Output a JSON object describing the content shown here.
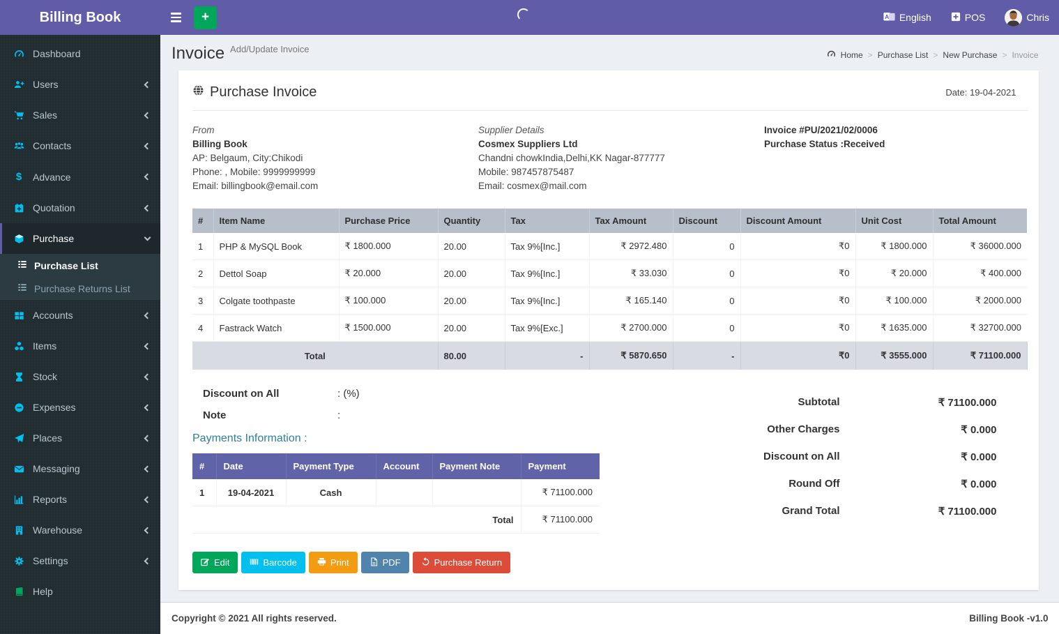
{
  "app": {
    "title": "Billing Book",
    "copyright": "Copyright © 2021 All rights reserved.",
    "version_label": "Billing Book -v1.0"
  },
  "topbar": {
    "language_label": "English",
    "pos_label": "POS",
    "user_name": "Chris"
  },
  "sidebar": {
    "items": [
      {
        "label": "Dashboard",
        "icon": "gauge-icon"
      },
      {
        "label": "Users",
        "icon": "user-plus-icon"
      },
      {
        "label": "Sales",
        "icon": "cart-icon"
      },
      {
        "label": "Contacts",
        "icon": "users-icon"
      },
      {
        "label": "Advance",
        "icon": "dollar-icon"
      },
      {
        "label": "Quotation",
        "icon": "calendar-plus-icon"
      },
      {
        "label": "Purchase",
        "icon": "cube-icon"
      },
      {
        "label": "Accounts",
        "icon": "grid-icon"
      },
      {
        "label": "Items",
        "icon": "cubes-icon"
      },
      {
        "label": "Stock",
        "icon": "hourglass-icon"
      },
      {
        "label": "Expenses",
        "icon": "minus-circle-icon"
      },
      {
        "label": "Places",
        "icon": "paper-plane-icon"
      },
      {
        "label": "Messaging",
        "icon": "envelope-icon"
      },
      {
        "label": "Reports",
        "icon": "bar-chart-icon"
      },
      {
        "label": "Warehouse",
        "icon": "building-icon"
      },
      {
        "label": "Settings",
        "icon": "gears-icon"
      },
      {
        "label": "Help",
        "icon": "book-icon"
      }
    ],
    "purchase_submenu": [
      {
        "label": "Purchase List",
        "active": true
      },
      {
        "label": "Purchase Returns List",
        "active": false
      }
    ]
  },
  "page": {
    "title": "Invoice",
    "subtitle": "Add/Update Invoice",
    "breadcrumb": [
      "Home",
      "Purchase List",
      "New Purchase",
      "Invoice"
    ]
  },
  "invoice": {
    "card_title": "Purchase Invoice",
    "date_label": "Date: 19-04-2021",
    "from": {
      "heading": "From",
      "name": "Billing Book",
      "address": "AP: Belgaum, City:Chikodi",
      "phone": "Phone: , Mobile: 9999999999",
      "email": "Email: billingbook@email.com"
    },
    "supplier": {
      "heading": "Supplier Details",
      "name": "Cosmex Suppliers Ltd",
      "address": "Chandni chowkIndia,Delhi,KK Nagar-877777",
      "mobile": "Mobile: 987457875487",
      "email": "Email: cosmex@mail.com"
    },
    "meta": {
      "number": "Invoice #PU/2021/02/0006",
      "status": "Purchase Status :Received"
    },
    "items_table": {
      "headers": [
        "#",
        "Item Name",
        "Purchase Price",
        "Quantity",
        "Tax",
        "Tax Amount",
        "Discount",
        "Discount Amount",
        "Unit Cost",
        "Total Amount"
      ],
      "rows": [
        [
          "1",
          "PHP & MySQL Book",
          "₹ 1800.000",
          "20.00",
          "Tax 9%[Inc.]",
          "₹ 2972.480",
          "0",
          "₹0",
          "₹ 1800.000",
          "₹ 36000.000"
        ],
        [
          "2",
          "Dettol Soap",
          "₹ 20.000",
          "20.00",
          "Tax 9%[Inc.]",
          "₹ 33.030",
          "0",
          "₹0",
          "₹ 20.000",
          "₹ 400.000"
        ],
        [
          "3",
          "Colgate toothpaste",
          "₹ 100.000",
          "20.00",
          "Tax 9%[Inc.]",
          "₹ 165.140",
          "0",
          "₹0",
          "₹ 100.000",
          "₹ 2000.000"
        ],
        [
          "4",
          "Fastrack Watch",
          "₹ 1500.000",
          "20.00",
          "Tax 9%[Exc.]",
          "₹ 2700.000",
          "0",
          "₹0",
          "₹ 1635.000",
          "₹ 32700.000"
        ]
      ],
      "total_row": [
        "Total",
        "80.00",
        "-",
        "₹ 5870.650",
        "-",
        "₹0",
        "₹ 3555.000",
        "₹ 71100.000"
      ]
    },
    "discount_on_all_label": "Discount on All",
    "discount_on_all_value": ": (%)",
    "note_label": "Note",
    "note_value": ":",
    "payments": {
      "heading": "Payments Information :",
      "headers": [
        "#",
        "Date",
        "Payment Type",
        "Account",
        "Payment Note",
        "Payment"
      ],
      "rows": [
        [
          "1",
          "19-04-2021",
          "Cash",
          "",
          "",
          "₹ 71100.000"
        ]
      ],
      "total_label": "Total",
      "total_value": "₹ 71100.000"
    },
    "summary": [
      {
        "label": "Subtotal",
        "value": "₹ 71100.000"
      },
      {
        "label": "Other Charges",
        "value": "₹ 0.000"
      },
      {
        "label": "Discount on All",
        "value": "₹ 0.000"
      },
      {
        "label": "Round Off",
        "value": "₹ 0.000"
      },
      {
        "label": "Grand Total",
        "value": "₹ 71100.000"
      }
    ],
    "actions": [
      {
        "label": "Edit",
        "icon": "edit-icon",
        "color": "#00a65a"
      },
      {
        "label": "Barcode",
        "icon": "barcode-icon",
        "color": "#00c0ef"
      },
      {
        "label": "Print",
        "icon": "printer-icon",
        "color": "#f39c12"
      },
      {
        "label": "PDF",
        "icon": "file-pdf-icon",
        "color": "#5084ad"
      },
      {
        "label": "Purchase Return",
        "icon": "undo-icon",
        "color": "#dd4b39"
      }
    ]
  },
  "colors": {
    "brand_purple": "#605ca8",
    "sidebar_dark": "#222d32",
    "icon_cyan": "#00c0ef",
    "payments_header_purple": "#6163a8",
    "items_header_gray": "#b6bfca",
    "payments_heading_teal": "#2d7f9d",
    "success_green": "#00a65a",
    "warning_orange": "#f39c12",
    "pdf_blue": "#5084ad",
    "danger_red": "#dd4b39"
  }
}
